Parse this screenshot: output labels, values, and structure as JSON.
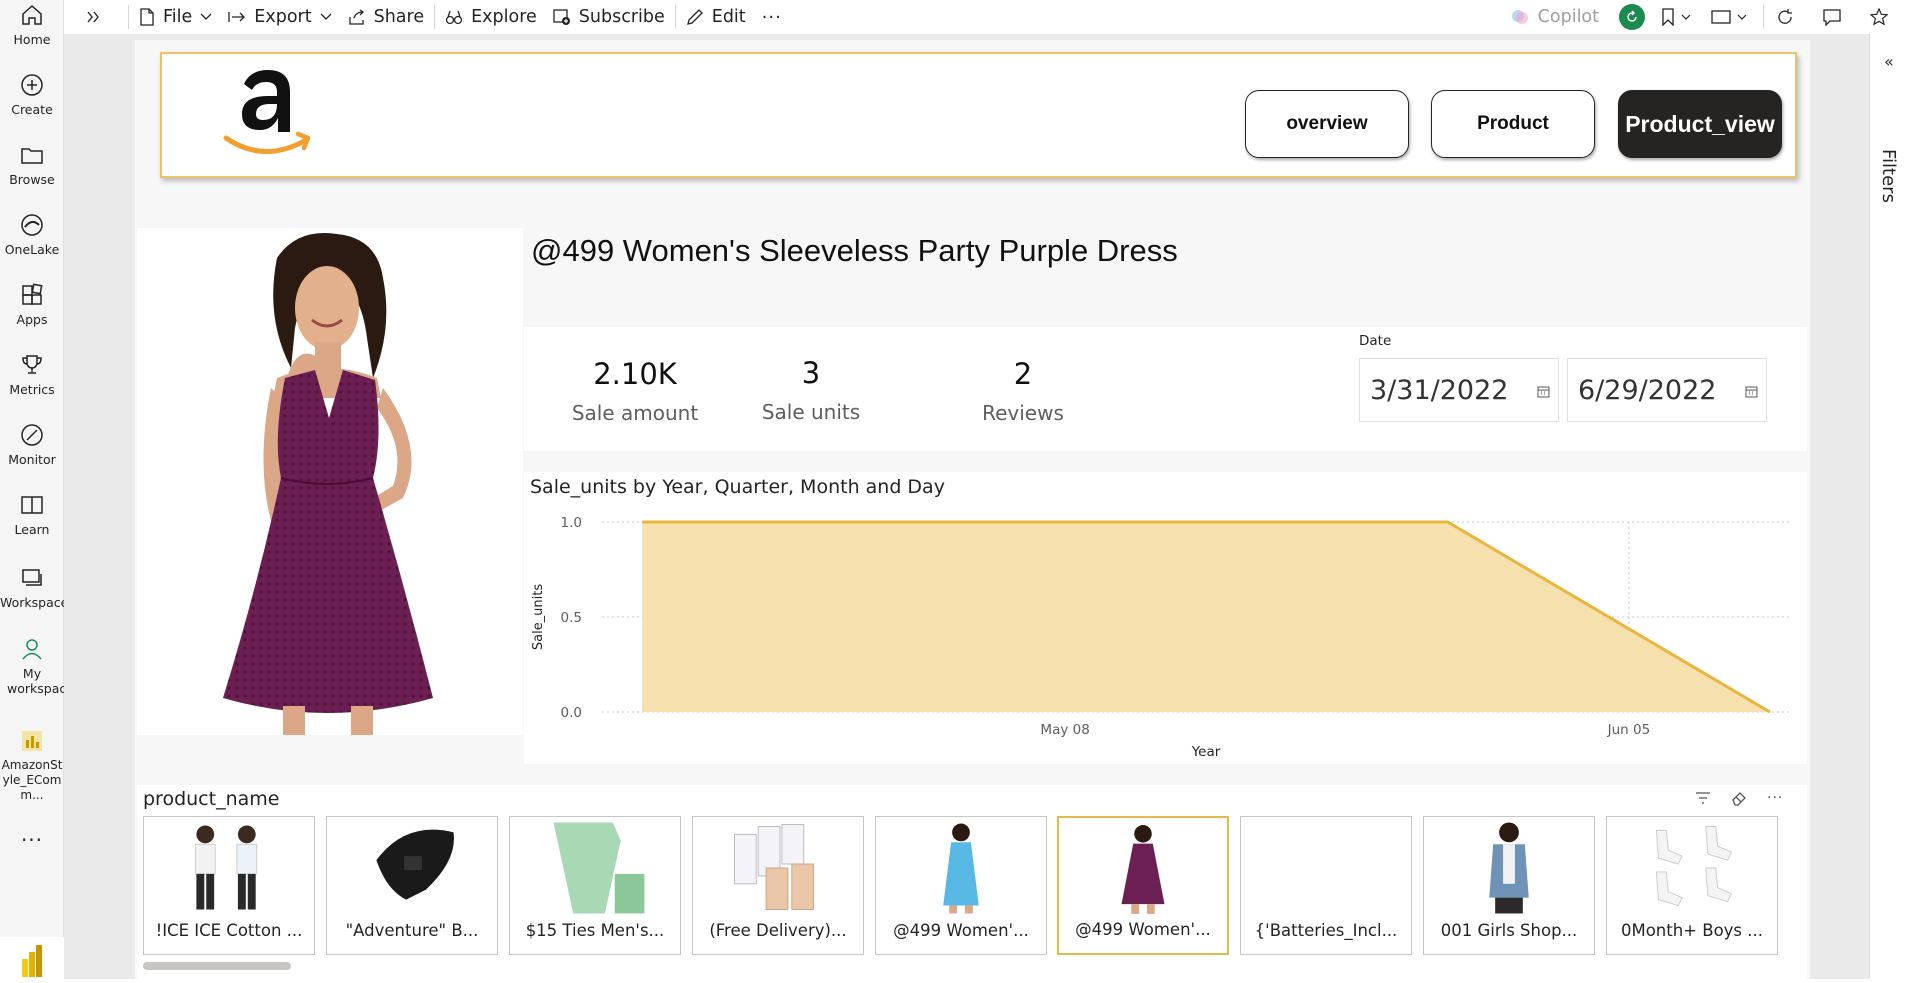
{
  "leftnav": {
    "items": [
      {
        "label": "Home",
        "icon": "home-icon"
      },
      {
        "label": "Create",
        "icon": "plus-circle-icon"
      },
      {
        "label": "Browse",
        "icon": "folder-icon"
      },
      {
        "label": "OneLake",
        "icon": "onelake-icon"
      },
      {
        "label": "Apps",
        "icon": "apps-icon"
      },
      {
        "label": "Metrics",
        "icon": "trophy-icon"
      },
      {
        "label": "Monitor",
        "icon": "monitor-icon"
      },
      {
        "label": "Learn",
        "icon": "book-icon"
      },
      {
        "label": "Workspaces",
        "icon": "workspaces-icon"
      },
      {
        "label": "My workspace",
        "icon": "user-icon"
      },
      {
        "label": "AmazonStyle_EComm...",
        "icon": "report-icon"
      }
    ],
    "more": "..."
  },
  "toolbar": {
    "file": "File",
    "export": "Export",
    "share": "Share",
    "explore": "Explore",
    "subscribe": "Subscribe",
    "edit": "Edit",
    "more": "···",
    "copilot": "Copilot"
  },
  "filters": {
    "label": "Filters",
    "collapse": "«"
  },
  "banner": {
    "logo": "amazon-logo",
    "buttons": [
      {
        "label": "overview",
        "active": false
      },
      {
        "label": "Product",
        "active": false
      },
      {
        "label": "Product_view",
        "active": true
      }
    ]
  },
  "product": {
    "title": "@499 Women's Sleeveless Party Purple Dress"
  },
  "kpis": [
    {
      "value": "2.10K",
      "label": "Sale amount"
    },
    {
      "value": "3",
      "label": "Sale units"
    },
    {
      "value": "2",
      "label": "Reviews"
    }
  ],
  "date_filter": {
    "label": "Date",
    "start": "3/31/2022",
    "end": "6/29/2022"
  },
  "chart_title": "Sale_units by Year, Quarter, Month and Day",
  "chart_data": {
    "type": "area",
    "title": "Sale_units by Year, Quarter, Month and Day",
    "xlabel": "Year",
    "ylabel": "Sale_units",
    "x": [
      "2022-04-17",
      "2022-05-27",
      "2022-06-12"
    ],
    "values": [
      1.0,
      1.0,
      0.0
    ],
    "x_ticks": [
      "May 08",
      "Jun 05"
    ],
    "y_ticks": [
      "0.0",
      "0.5",
      "1.0"
    ],
    "ylim": [
      0,
      1
    ],
    "grid": true,
    "color": "#e8b53d",
    "fill": "#f5dfaa"
  },
  "slicer": {
    "title": "product_name",
    "items": [
      {
        "label": "!ICE ICE Cotton ...",
        "selected": false
      },
      {
        "label": "\"Adventure\" B...",
        "selected": false
      },
      {
        "label": "$15 Ties Men's...",
        "selected": false
      },
      {
        "label": "(Free Delivery)...",
        "selected": false
      },
      {
        "label": "@499 Women'...",
        "selected": false
      },
      {
        "label": "@499 Women'...",
        "selected": true
      },
      {
        "label": "{'Batteries_Incl...",
        "selected": false
      },
      {
        "label": "001 Girls Shop...",
        "selected": false
      },
      {
        "label": "0Month+ Boys ...",
        "selected": false
      }
    ]
  },
  "colors": {
    "accent": "#e8b53d",
    "banner_border": "#e8c36a",
    "active_button": "#252423"
  }
}
